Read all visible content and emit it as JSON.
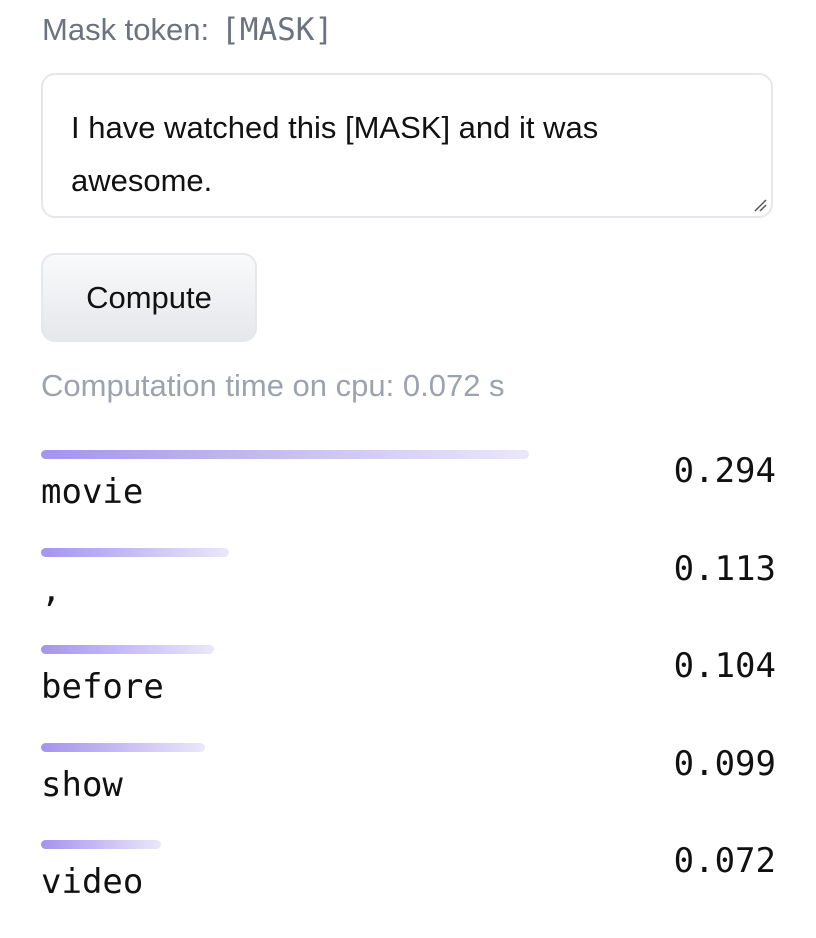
{
  "mask": {
    "label": "Mask token:",
    "token": "[MASK]"
  },
  "input": {
    "value": "I have watched this [MASK] and it was awesome."
  },
  "compute_button": {
    "label": "Compute"
  },
  "timing": {
    "text": "Computation time on cpu: 0.072 s"
  },
  "results": [
    {
      "token": "movie",
      "score": "0.294",
      "score_value": 0.294
    },
    {
      "token": ",",
      "score": "0.113",
      "score_value": 0.113
    },
    {
      "token": "before",
      "score": "0.104",
      "score_value": 0.104
    },
    {
      "token": "show",
      "score": "0.099",
      "score_value": 0.099
    },
    {
      "token": "video",
      "score": "0.072",
      "score_value": 0.072
    }
  ],
  "colors": {
    "bar_start": "#a494ee",
    "bar_end": "#ebe7fb",
    "muted_text": "#9ca3af"
  }
}
